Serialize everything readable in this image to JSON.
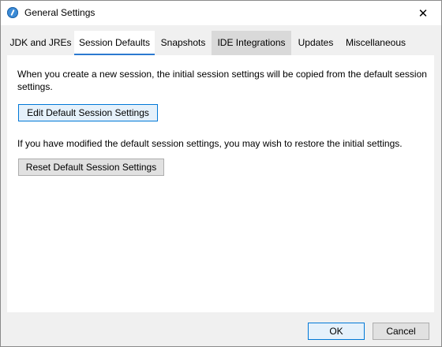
{
  "window": {
    "title": "General Settings",
    "icons": {
      "app": "app-icon",
      "close": "close-icon"
    },
    "close_glyph": "✕"
  },
  "tabs": [
    {
      "label": "JDK and JREs",
      "selected": false
    },
    {
      "label": "Session Defaults",
      "selected": true
    },
    {
      "label": "Snapshots",
      "selected": false
    },
    {
      "label": "IDE Integrations",
      "selected": false,
      "hovered": true
    },
    {
      "label": "Updates",
      "selected": false
    },
    {
      "label": "Miscellaneous",
      "selected": false
    }
  ],
  "panel": {
    "intro_text": "When you create a new session, the initial session settings will be copied from the default session settings.",
    "edit_button": "Edit Default Session Settings",
    "restore_text": "If you have modified the default session settings, you may wish to restore the initial settings.",
    "reset_button": "Reset Default Session Settings"
  },
  "footer": {
    "ok_label": "OK",
    "cancel_label": "Cancel"
  },
  "colors": {
    "accent": "#0078d7",
    "tab_underline": "#2b79d0",
    "dialog_background": "#f0f0f0"
  }
}
